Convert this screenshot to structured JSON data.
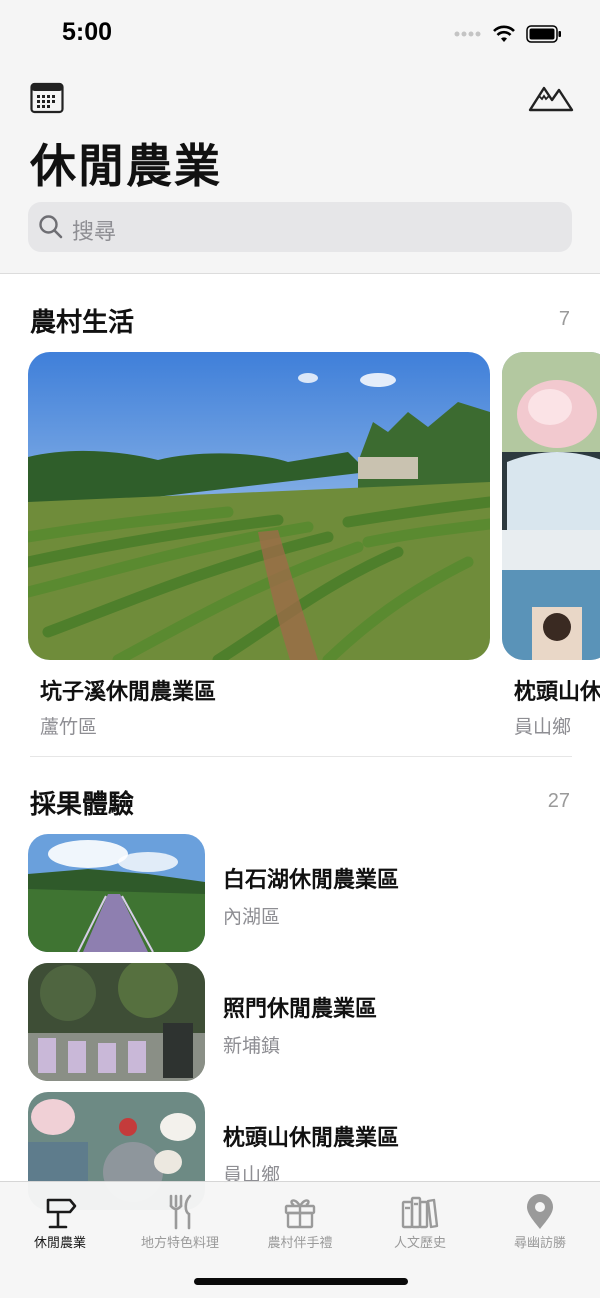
{
  "status_bar": {
    "time": "5:00"
  },
  "header": {
    "title": "休閒農業",
    "search_placeholder": "搜尋",
    "calendar_icon": "calendar-icon",
    "mountain_icon": "mountain-icon"
  },
  "sections": [
    {
      "title": "農村生活",
      "count": "7",
      "cards": [
        {
          "name": "坑子溪休閒農業區",
          "area": "蘆竹區"
        },
        {
          "name": "枕頭山休",
          "area": "員山鄉"
        }
      ]
    },
    {
      "title": "採果體驗",
      "count": "27",
      "rows": [
        {
          "name": "白石湖休閒農業區",
          "area": "內湖區"
        },
        {
          "name": "照門休閒農業區",
          "area": "新埔鎮"
        },
        {
          "name": "枕頭山休閒農業區",
          "area": "員山鄉"
        }
      ]
    }
  ],
  "tabbar": {
    "tabs": [
      {
        "label": "休閒農業",
        "icon": "signpost-icon",
        "active": true
      },
      {
        "label": "地方特色料理",
        "icon": "fork-knife-icon",
        "active": false
      },
      {
        "label": "農村伴手禮",
        "icon": "gift-icon",
        "active": false
      },
      {
        "label": "人文歷史",
        "icon": "books-icon",
        "active": false
      },
      {
        "label": "尋幽訪勝",
        "icon": "location-pin-icon",
        "active": false
      }
    ]
  },
  "colors": {
    "header_bg": "#f5f5f5",
    "secondary_text": "#8e8e93",
    "tab_inactive": "#9a9a9a",
    "tab_active": "#1a1a1a"
  }
}
